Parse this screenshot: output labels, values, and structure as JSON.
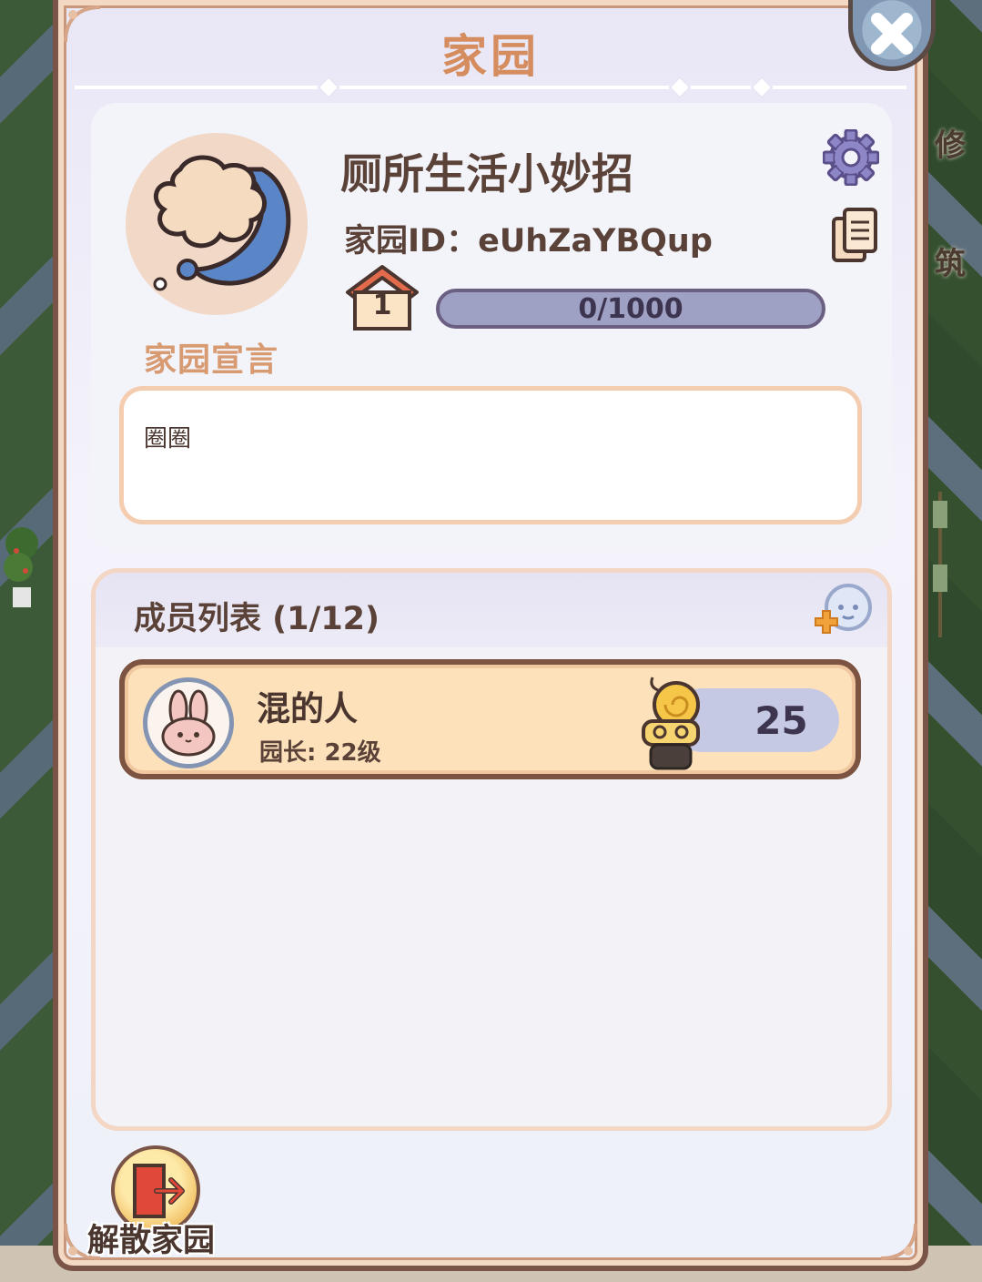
{
  "panel": {
    "title": "家园"
  },
  "side_labels": [
    "修",
    "筑"
  ],
  "home": {
    "name": "厕所生活小妙招",
    "id_text": "家园ID：eUhZaYBQup",
    "level": "1",
    "progress_text": "0/1000",
    "progress_fraction": 0,
    "motto_label": "家园宣言",
    "motto": "圈圈"
  },
  "members": {
    "title": "成员列表 (1/12)",
    "list": [
      {
        "name": "混的人",
        "role": "园长: 22级",
        "score": "25"
      }
    ]
  },
  "dissolve": {
    "label": "解散家园"
  },
  "colors": {
    "title": "#d58c5e",
    "frame": "#7a5446",
    "row_bg": "#fde1bb",
    "progress_track": "#9ea0c4"
  },
  "icons": [
    "close-icon",
    "gear-icon",
    "copy-icon",
    "house-level-icon",
    "add-member-icon",
    "bunny-avatar-icon",
    "snail-icon",
    "exit-door-icon",
    "cloud-emblem-icon"
  ]
}
